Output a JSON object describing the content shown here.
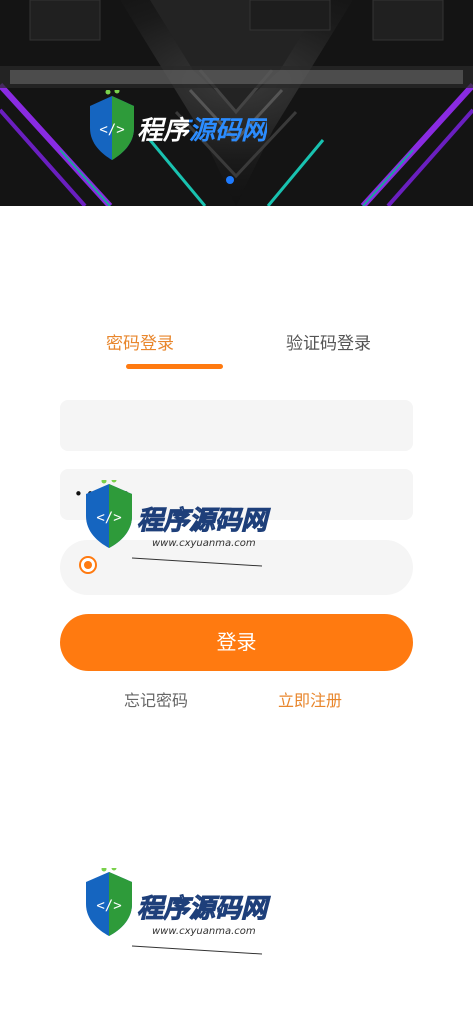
{
  "banner": {
    "logo_text": "程序源码网"
  },
  "tabs": [
    {
      "label": "密码登录",
      "active": true
    },
    {
      "label": "验证码登录",
      "active": false
    }
  ],
  "password_mask": "•••••",
  "login_button_label": "登录",
  "links": {
    "forgot": "忘记密码",
    "register": "立即注册"
  },
  "watermark": {
    "title": "程序源码网",
    "url": "www.cxyuanma.com"
  },
  "colors": {
    "accent": "#ff7a10",
    "accent_text": "#e8862c",
    "field_bg": "#f5f5f5",
    "banner_dot": "#1e7bff"
  }
}
